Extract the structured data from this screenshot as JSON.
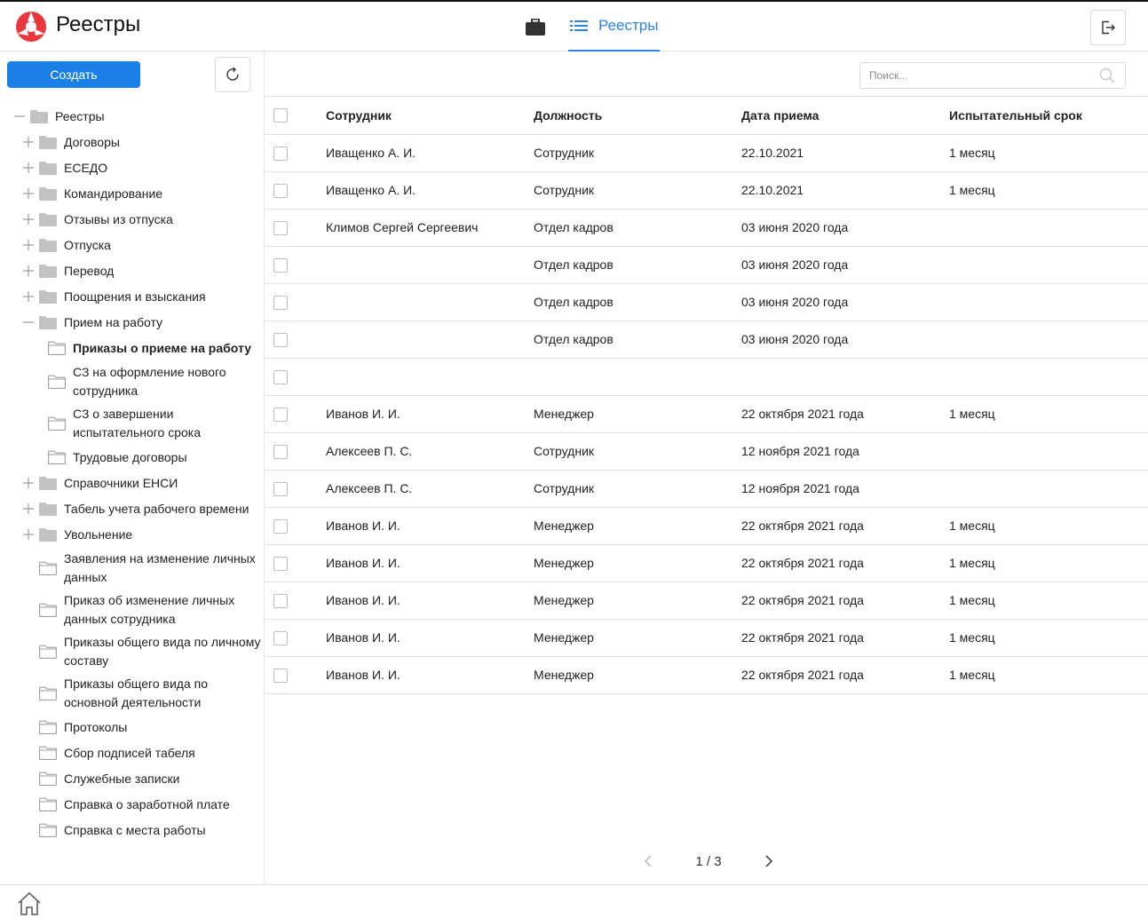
{
  "header": {
    "app_title": "Реестры",
    "nav_tab_label": "Реестры",
    "accent_color": "#2a83e6"
  },
  "sidebar": {
    "create_label": "Создать",
    "tree": [
      {
        "label": "Реестры",
        "level": 0,
        "toggle": "minus",
        "folder": "filled"
      },
      {
        "label": "Договоры",
        "level": 1,
        "toggle": "plus",
        "folder": "filled"
      },
      {
        "label": "ЕСЕДО",
        "level": 1,
        "toggle": "plus",
        "folder": "filled"
      },
      {
        "label": "Командирование",
        "level": 1,
        "toggle": "plus",
        "folder": "filled"
      },
      {
        "label": "Отзывы из отпуска",
        "level": 1,
        "toggle": "plus",
        "folder": "filled"
      },
      {
        "label": "Отпуска",
        "level": 1,
        "toggle": "plus",
        "folder": "filled"
      },
      {
        "label": "Перевод",
        "level": 1,
        "toggle": "plus",
        "folder": "filled"
      },
      {
        "label": "Поощрения и взыскания",
        "level": 1,
        "toggle": "plus",
        "folder": "filled"
      },
      {
        "label": "Прием на работу",
        "level": 1,
        "toggle": "minus",
        "folder": "filled"
      },
      {
        "label": "Приказы о приеме на работу",
        "level": 2,
        "folder": "outline",
        "selected": true
      },
      {
        "label": "СЗ на оформление нового сотрудника",
        "level": 2,
        "folder": "outline"
      },
      {
        "label": "СЗ о завершении испытательного срока",
        "level": 2,
        "folder": "outline"
      },
      {
        "label": "Трудовые договоры",
        "level": 2,
        "folder": "outline"
      },
      {
        "label": "Справочники ЕНСИ",
        "level": 1,
        "toggle": "plus",
        "folder": "filled"
      },
      {
        "label": "Табель учета рабочего времени",
        "level": 1,
        "toggle": "plus",
        "folder": "filled"
      },
      {
        "label": "Увольнение",
        "level": 1,
        "toggle": "plus",
        "folder": "filled"
      },
      {
        "label": "Заявления на изменение личных данных",
        "level": 1,
        "folder": "outline"
      },
      {
        "label": "Приказ об изменение личных данных сотрудника",
        "level": 1,
        "folder": "outline"
      },
      {
        "label": "Приказы общего вида по личному составу",
        "level": 1,
        "folder": "outline"
      },
      {
        "label": "Приказы общего вида по основной деятельности",
        "level": 1,
        "folder": "outline"
      },
      {
        "label": "Протоколы",
        "level": 1,
        "folder": "outline"
      },
      {
        "label": "Сбор подписей табеля",
        "level": 1,
        "folder": "outline"
      },
      {
        "label": "Служебные записки",
        "level": 1,
        "folder": "outline"
      },
      {
        "label": "Справка о заработной плате",
        "level": 1,
        "folder": "outline"
      },
      {
        "label": "Справка с места работы",
        "level": 1,
        "folder": "outline"
      }
    ]
  },
  "main": {
    "search_placeholder": "Поиск...",
    "columns": [
      "Сотрудник",
      "Должность",
      "Дата приема",
      "Испытательный срок"
    ],
    "rows": [
      [
        "Иващенко А. И.",
        "Сотрудник",
        "22.10.2021",
        "1 месяц"
      ],
      [
        "Иващенко А. И.",
        "Сотрудник",
        "22.10.2021",
        "1 месяц"
      ],
      [
        "Климов Сергей Сергеевич",
        "Отдел кадров",
        "03 июня 2020 года",
        ""
      ],
      [
        "",
        "Отдел кадров",
        "03 июня 2020 года",
        ""
      ],
      [
        "",
        "Отдел кадров",
        "03 июня 2020 года",
        ""
      ],
      [
        "",
        "Отдел кадров",
        "03 июня 2020 года",
        ""
      ],
      [
        "",
        "",
        "",
        ""
      ],
      [
        "Иванов И. И.",
        "Менеджер",
        "22 октября 2021 года",
        "1 месяц"
      ],
      [
        "Алексеев П. С.",
        "Сотрудник",
        "12 ноября 2021 года",
        ""
      ],
      [
        "Алексеев П. С.",
        "Сотрудник",
        "12 ноября 2021 года",
        ""
      ],
      [
        "Иванов И. И.",
        "Менеджер",
        "22 октября 2021 года",
        "1 месяц"
      ],
      [
        "Иванов И. И.",
        "Менеджер",
        "22 октября 2021 года",
        "1 месяц"
      ],
      [
        "Иванов И. И.",
        "Менеджер",
        "22 октября 2021 года",
        "1 месяц"
      ],
      [
        "Иванов И. И.",
        "Менеджер",
        "22 октября 2021 года",
        "1 месяц"
      ],
      [
        "Иванов И. И.",
        "Менеджер",
        "22 октября 2021 года",
        "1 месяц"
      ]
    ],
    "pager_text": "1 / 3"
  }
}
